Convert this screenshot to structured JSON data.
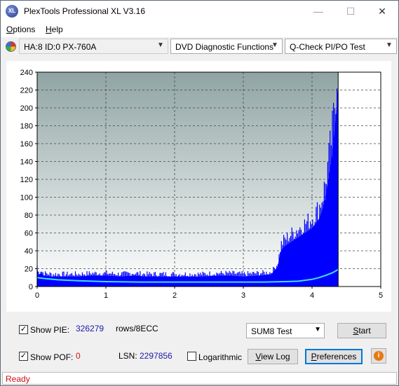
{
  "window": {
    "title": "PlexTools Professional XL V3.16",
    "app_icon_text": "XL"
  },
  "menu": {
    "options": {
      "underline": "O",
      "rest": "ptions"
    },
    "help": {
      "underline": "H",
      "rest": "elp"
    }
  },
  "toolbar": {
    "drive": "HA:8 ID:0  PX-760A",
    "function": "DVD Diagnostic Functions",
    "test": "Q-Check PI/PO Test"
  },
  "chart_data": {
    "type": "area",
    "x_ticks": [
      "0",
      "1",
      "2",
      "3",
      "4",
      "5"
    ],
    "y_ticks": [
      "0",
      "20",
      "40",
      "60",
      "80",
      "100",
      "120",
      "140",
      "160",
      "180",
      "200",
      "220",
      "240"
    ],
    "xlim": [
      0,
      5
    ],
    "ylim": [
      0,
      240
    ],
    "grid": true,
    "end_x": 4.38,
    "series": [
      {
        "color": "#0000ff",
        "x": [
          0,
          0.02,
          0.05,
          0.1,
          0.2,
          0.4,
          0.6,
          0.8,
          1.0,
          1.2,
          1.4,
          1.6,
          1.8,
          2.0,
          2.2,
          2.4,
          2.6,
          2.8,
          3.0,
          3.2,
          3.4,
          3.5,
          3.55,
          3.6,
          3.7,
          3.8,
          3.9,
          4.0,
          4.05,
          4.1,
          4.15,
          4.2,
          4.25,
          4.3,
          4.33,
          4.35,
          4.37,
          4.38
        ],
        "y": [
          20,
          12,
          15,
          12,
          11,
          11,
          11,
          12,
          12,
          11,
          12,
          11,
          11,
          11,
          11,
          11,
          12,
          12,
          11,
          12,
          13,
          22,
          40,
          45,
          50,
          55,
          60,
          65,
          70,
          75,
          85,
          100,
          125,
          150,
          175,
          190,
          215,
          220
        ]
      },
      {
        "color": "#40e0ff",
        "x": [
          0,
          0.1,
          0.3,
          0.6,
          1.0,
          1.5,
          2.0,
          2.5,
          3.0,
          3.3,
          3.6,
          3.8,
          4.0,
          4.1,
          4.2,
          4.3,
          4.38
        ],
        "y": [
          10,
          9,
          7.5,
          6.5,
          5.5,
          5,
          5,
          5,
          5,
          5,
          5.5,
          6,
          8,
          10,
          12.5,
          15.5,
          19
        ]
      }
    ]
  },
  "controls": {
    "show_pie_label": "Show PIE:",
    "pie_value": "326279",
    "rows_label": "rows/8ECC",
    "show_pof_label": "Show POF:",
    "pof_value": "0",
    "lsn_label": "LSN:",
    "lsn_value": "2297856",
    "logarithmic_label": "Logarithmic",
    "sum_test": "SUM8 Test",
    "start_button": {
      "underline": "S",
      "rest": "tart"
    },
    "view_log_button": {
      "underline": "V",
      "rest": "iew Log"
    },
    "preferences_button": {
      "underline": "P",
      "rest": "references"
    },
    "show_pie_checked": true,
    "show_pof_checked": true,
    "logarithmic_checked": false
  },
  "status": {
    "text": "Ready"
  }
}
